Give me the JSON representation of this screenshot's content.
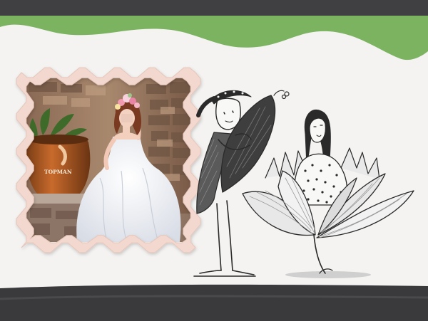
{
  "scene": {
    "pot_label": "TOPMAN",
    "colors": {
      "top_band": "#404042",
      "green_wave": "#7bb361",
      "paper": "#f4f3f1",
      "frame": "#f2d8cf",
      "bottom_band": "#3a3a3c"
    },
    "illustration": {
      "left_figure": "man-hugging-leaf",
      "right_figure": "girl-in-lotus-flower"
    }
  }
}
